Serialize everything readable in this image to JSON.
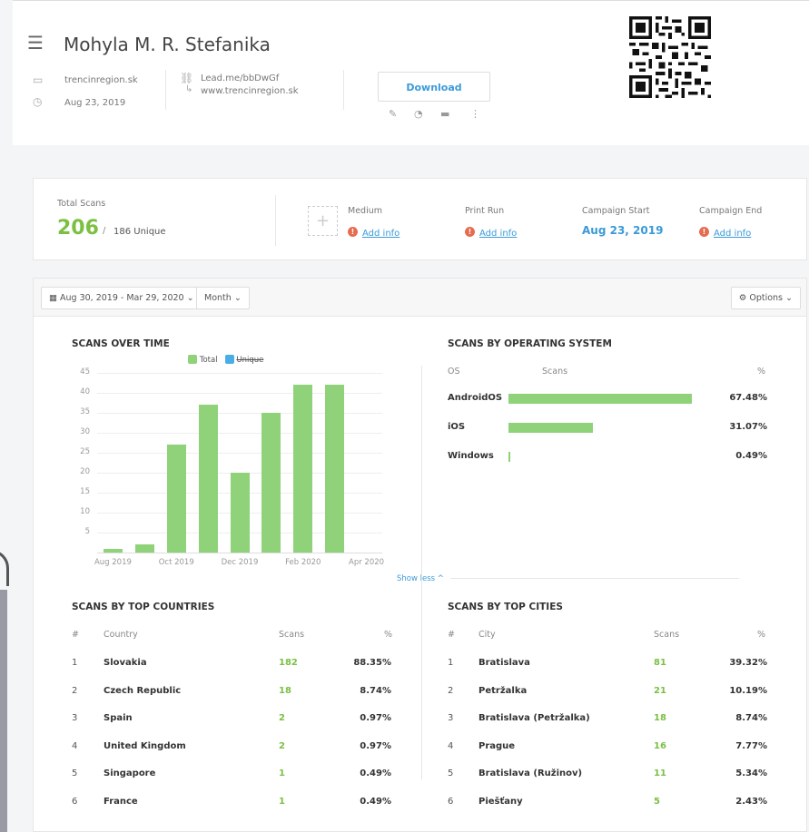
{
  "header": {
    "title": "Mohyla M. R. Stefanika",
    "domain": "trencinregion.sk",
    "date": "Aug 23, 2019",
    "short_link": "Lead.me/bbDwGf",
    "target_url": "www.trencinregion.sk",
    "download_label": "Download"
  },
  "stats": {
    "total_scans_label": "Total Scans",
    "total_scans": "206",
    "unique_text": "186 Unique",
    "separator": "/",
    "medium_label": "Medium",
    "print_run_label": "Print Run",
    "campaign_start_label": "Campaign Start",
    "campaign_start": "Aug 23, 2019",
    "campaign_end_label": "Campaign End",
    "add_info": "Add info"
  },
  "toolbar": {
    "date_range": "Aug 30, 2019 - Mar 29, 2020",
    "granularity": "Month",
    "options": "Options"
  },
  "scans_over_time": {
    "title": "SCANS OVER TIME",
    "legend_total": "Total",
    "legend_unique": "Unique",
    "show_less": "Show less ^"
  },
  "chart_data": {
    "type": "bar",
    "title": "SCANS OVER TIME",
    "categories": [
      "Aug 2019",
      "Sep 2019",
      "Oct 2019",
      "Nov 2019",
      "Dec 2019",
      "Jan 2020",
      "Feb 2020",
      "Mar 2020",
      "Apr 2020"
    ],
    "x_tick_labels": [
      "Aug 2019",
      "Oct 2019",
      "Dec 2019",
      "Feb 2020",
      "Apr 2020"
    ],
    "series": [
      {
        "name": "Total",
        "values": [
          1,
          2,
          27,
          37,
          20,
          35,
          42,
          42,
          0
        ]
      }
    ],
    "ylim": [
      0,
      45
    ],
    "yticks": [
      5,
      10,
      15,
      20,
      25,
      30,
      35,
      40,
      45
    ],
    "grid": true,
    "legend": "top-center",
    "colors": {
      "Total": "#8fd27a",
      "Unique": "#4aaee6"
    }
  },
  "os": {
    "title": "SCANS BY OPERATING SYSTEM",
    "col_os": "OS",
    "col_scans": "Scans",
    "col_pct": "%",
    "rows": [
      {
        "name": "AndroidOS",
        "pct": "67.48%",
        "share": 0.6748
      },
      {
        "name": "iOS",
        "pct": "31.07%",
        "share": 0.3107
      },
      {
        "name": "Windows",
        "pct": "0.49%",
        "share": 0.0049
      }
    ]
  },
  "countries": {
    "title": "SCANS BY TOP COUNTRIES",
    "col_num": "#",
    "col_name": "Country",
    "col_scans": "Scans",
    "col_pct": "%",
    "rows": [
      {
        "n": "1",
        "name": "Slovakia",
        "scans": "182",
        "pct": "88.35%"
      },
      {
        "n": "2",
        "name": "Czech Republic",
        "scans": "18",
        "pct": "8.74%"
      },
      {
        "n": "3",
        "name": "Spain",
        "scans": "2",
        "pct": "0.97%"
      },
      {
        "n": "4",
        "name": "United Kingdom",
        "scans": "2",
        "pct": "0.97%"
      },
      {
        "n": "5",
        "name": "Singapore",
        "scans": "1",
        "pct": "0.49%"
      },
      {
        "n": "6",
        "name": "France",
        "scans": "1",
        "pct": "0.49%"
      }
    ]
  },
  "cities": {
    "title": "SCANS BY TOP CITIES",
    "col_num": "#",
    "col_name": "City",
    "col_scans": "Scans",
    "col_pct": "%",
    "rows": [
      {
        "n": "1",
        "name": "Bratislava",
        "scans": "81",
        "pct": "39.32%"
      },
      {
        "n": "2",
        "name": "Petržalka",
        "scans": "21",
        "pct": "10.19%"
      },
      {
        "n": "3",
        "name": "Bratislava (Petržalka)",
        "scans": "18",
        "pct": "8.74%"
      },
      {
        "n": "4",
        "name": "Prague",
        "scans": "16",
        "pct": "7.77%"
      },
      {
        "n": "5",
        "name": "Bratislava (Ružinov)",
        "scans": "11",
        "pct": "5.34%"
      },
      {
        "n": "6",
        "name": "Piešťany",
        "scans": "5",
        "pct": "2.43%"
      }
    ]
  }
}
